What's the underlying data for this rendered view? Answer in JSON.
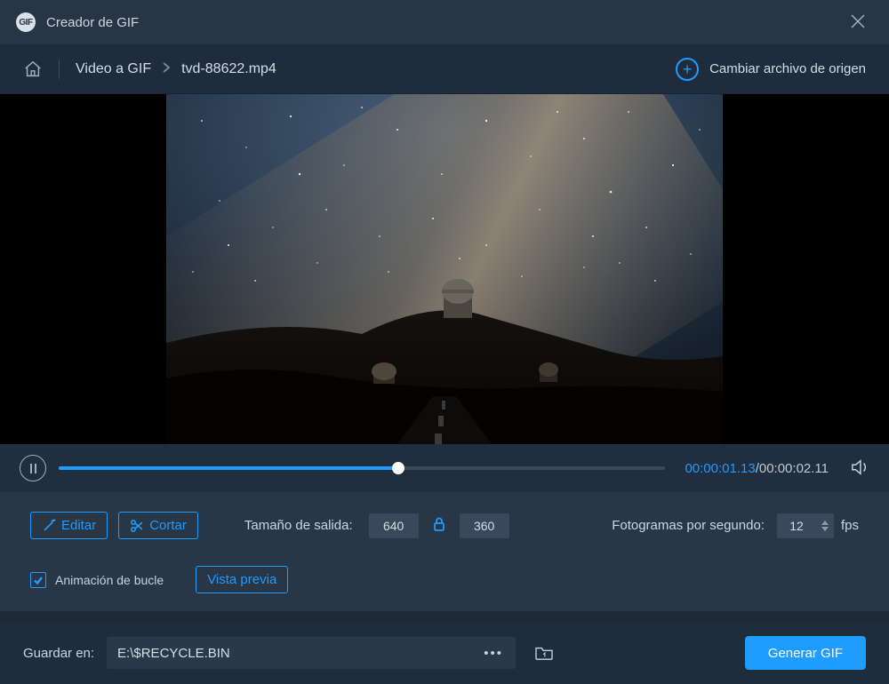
{
  "titlebar": {
    "app_icon_text": "GIF",
    "title": "Creador de GIF"
  },
  "breadcrumb": {
    "item1": "Video a GIF",
    "item2": "tvd-88622.mp4",
    "change_source": "Cambiar archivo de origen"
  },
  "transport": {
    "current_time": "00:00:01.13",
    "total_time": "00:00:02.11",
    "separator": "/",
    "progress_percent": 56
  },
  "settings": {
    "edit_label": "Editar",
    "cut_label": "Cortar",
    "output_size_label": "Tamaño de salida:",
    "width_value": "640",
    "height_value": "360",
    "fps_label": "Fotogramas por segundo:",
    "fps_value": "12",
    "fps_unit": "fps",
    "loop_label": "Animación de bucle",
    "preview_label": "Vista previa",
    "loop_checked": true
  },
  "footer": {
    "save_in_label": "Guardar en:",
    "save_path_value": "E:\\$RECYCLE.BIN",
    "generate_label": "Generar GIF"
  },
  "icons": {
    "app": "gif-icon",
    "close": "close-icon",
    "home": "home-icon",
    "chevron": "chevron-right-icon",
    "plus": "plus-circle-icon",
    "pause": "pause-icon",
    "volume": "volume-icon",
    "wand": "wand-icon",
    "scissors": "scissors-icon",
    "lock": "lock-icon",
    "check": "check-icon",
    "dots": "more-icon",
    "folder": "folder-icon"
  },
  "colors": {
    "accent": "#1f9cff",
    "panel_dark": "#1f2c3b",
    "panel_mid": "#283646",
    "input_bg": "#39485a"
  }
}
